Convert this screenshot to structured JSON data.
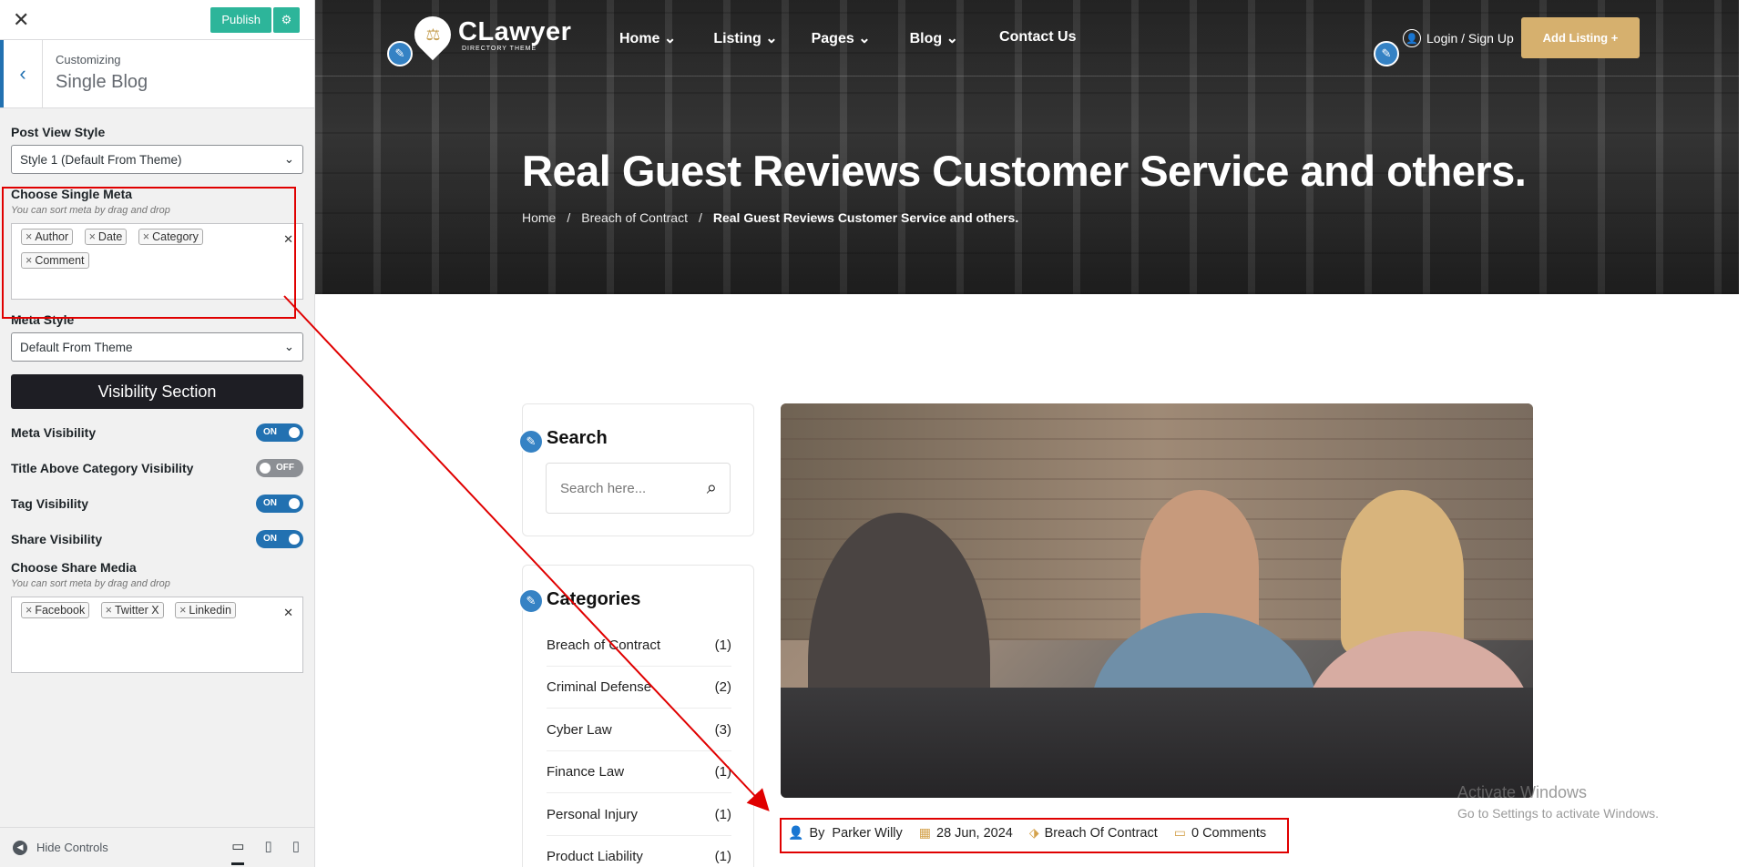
{
  "panel": {
    "publish_label": "Publish",
    "customizing_label": "Customizing",
    "section_title": "Single Blog",
    "post_view_style": {
      "label": "Post View Style",
      "value": "Style 1 (Default From Theme)"
    },
    "single_meta": {
      "label": "Choose Single Meta",
      "hint": "You can sort meta by drag and drop",
      "tags": [
        "Author",
        "Date",
        "Category",
        "Comment"
      ]
    },
    "meta_style": {
      "label": "Meta Style",
      "value": "Default From Theme"
    },
    "visibility_heading": "Visibility Section",
    "toggles": [
      {
        "label": "Meta Visibility",
        "state": "ON"
      },
      {
        "label": "Title Above Category Visibility",
        "state": "OFF"
      },
      {
        "label": "Tag Visibility",
        "state": "ON"
      },
      {
        "label": "Share Visibility",
        "state": "ON"
      }
    ],
    "share_media": {
      "label": "Choose Share Media",
      "hint": "You can sort meta by drag and drop",
      "tags": [
        "Facebook",
        "Twitter X",
        "Linkedin"
      ]
    },
    "hide_controls": "Hide Controls"
  },
  "site": {
    "logo_name": "CLawyer",
    "logo_tagline": "DIRECTORY THEME",
    "nav": [
      "Home",
      "Listing",
      "Pages",
      "Blog",
      "Contact Us"
    ],
    "login": "Login / Sign Up",
    "add_listing": "Add Listing",
    "hero_title": "Real Guest Reviews Customer Service and others.",
    "breadcrumb": [
      "Home",
      "Breach of Contract",
      "Real Guest Reviews Customer Service and others."
    ],
    "search": {
      "title": "Search",
      "placeholder": "Search here..."
    },
    "categories": {
      "title": "Categories",
      "items": [
        {
          "name": "Breach of Contract",
          "count": "(1)"
        },
        {
          "name": "Criminal Defense",
          "count": "(2)"
        },
        {
          "name": "Cyber Law",
          "count": "(3)"
        },
        {
          "name": "Finance Law",
          "count": "(1)"
        },
        {
          "name": "Personal Injury",
          "count": "(1)"
        },
        {
          "name": "Product Liability",
          "count": "(1)"
        }
      ]
    },
    "meta": {
      "by": "By",
      "author": "Parker Willy",
      "date": "28 Jun, 2024",
      "category": "Breach Of Contract",
      "comments": "0 Comments"
    },
    "watermark": {
      "line1": "Activate Windows",
      "line2": "Go to Settings to activate Windows."
    }
  },
  "colors": {
    "accent": "#2271b1",
    "publish": "#2db59a",
    "gold": "#d6b06e",
    "highlight": "#e00000"
  }
}
